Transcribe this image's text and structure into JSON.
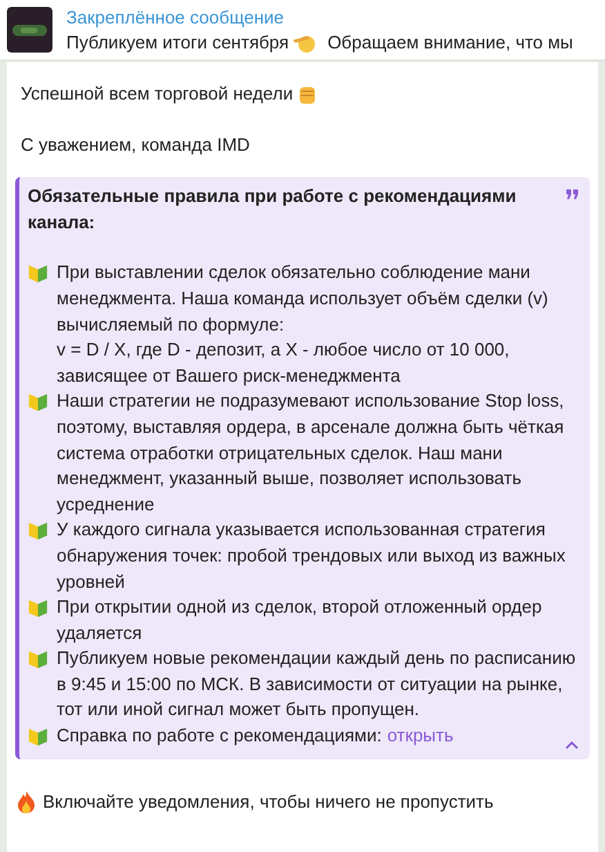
{
  "pinned": {
    "title": "Закреплённое сообщение",
    "preview_start": "Публикуем итоги сентября",
    "preview_end": "Обращаем внимание, что мы"
  },
  "message": {
    "paragraphs": [
      "Успешной всем торговой недели",
      "С уважением, команда IMD"
    ],
    "quote": {
      "title": "Обязательные правила при работе с рекомендациями канала:",
      "expanded": true,
      "items": [
        {
          "text": "При выставлении сделок обязательно соблюдение мани менеджмента. Наша команда использует объём сделки (v)  вычисляемый по формуле:\nv = D / X, где D - депозит, а X - любое число от 10 000, зависящее от Вашего риск-менеджмента"
        },
        {
          "text": "Наши стратегии не подразумевают использование Stop loss, поэтому, выставляя ордера, в арсенале должна быть чёткая система отработки отрицательных сделок. Наш мани менеджмент, указанный выше, позволяет использовать усреднение"
        },
        {
          "text": "У каждого сигнала указывается использованная стратегия обнаружения точек: пробой трендовых или выход из важных уровней"
        },
        {
          "text": "При открытии одной из сделок, второй отложенный ордер удаляется"
        },
        {
          "text": "Публикуем новые рекомендации каждый день по расписанию  в 9:45 и 15:00 по МСК. В зависимости от ситуации на рынке, тот или иной сигнал может быть пропущен."
        },
        {
          "text": "Справка по работе с рекомендациями:",
          "link": "открыть"
        }
      ]
    },
    "footer": "Включайте уведомления, чтобы ничего не пропустить"
  }
}
